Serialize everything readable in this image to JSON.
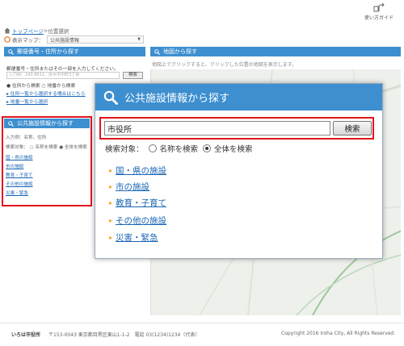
{
  "header": {
    "guide_label": "使い方ガイド"
  },
  "breadcrumb": {
    "home": "トップページ",
    "separator": ">",
    "current": "位置選択"
  },
  "map_select": {
    "label": "表示マップ：",
    "value": "公共施設情報"
  },
  "zip_panel": {
    "title": "郵便番号・住所から探す",
    "instruction": "郵便番号・住所またはその一部を入力してください。",
    "input_placeholder": "入力例：243-8511、厚木市中町3丁目",
    "search_label": "検索",
    "radio_address": "住所から検索",
    "radio_landmark": "地番から検索",
    "link_list": "住所一覧から選択する場合はこちら",
    "link_landmark": "地番一覧から選択"
  },
  "public_panel_small": {
    "title": "公共施設情報から探す",
    "input_placeholder": "入力例：名称、住所",
    "target_label": "検索対象：",
    "radio_name": "名称を検索",
    "radio_all": "全体を検索",
    "links": [
      "国・県の施設",
      "市の施設",
      "教育・子育て",
      "その他の施設",
      "災害・緊急"
    ]
  },
  "map_panel": {
    "title": "地図から探す",
    "hint": "地図上でクリックすると、クリックした位置の地図を表示します。"
  },
  "modal": {
    "title": "公共施設情報から探す",
    "search_value": "市役所",
    "search_label": "検索",
    "target_label": "検索対象：",
    "radio_name": "名称を検索",
    "radio_all": "全体を検索",
    "links": [
      "国・県の施設",
      "市の施設",
      "教育・子育て",
      "その他の施設",
      "災害・緊急"
    ]
  },
  "footer": {
    "city": "いろは市役所",
    "address": "〒153-0043 東京都目黒区東山1-1-2　電話 03(1234)1234（代表）",
    "copyright": "Copyright 2016 Iroha City, All Rights Reserved."
  },
  "colors": {
    "accent_blue": "#3d8fd0",
    "highlight_red": "#e0141e",
    "link_blue": "#1a66b5",
    "arrow_orange": "#f0a020"
  }
}
